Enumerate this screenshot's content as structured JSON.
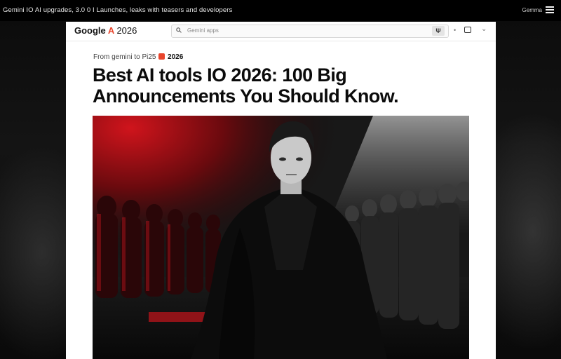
{
  "topbar": {
    "title": "Gemini IO AI upgrades, 3.0 0 I Launches, leaks with teasers and developers",
    "right_label": "Gemma",
    "menu_icon": "hamburger-icon"
  },
  "browser": {
    "logo_text": "Google",
    "logo_year": "2026",
    "search_placeholder": "Gemini apps",
    "icons": [
      "search-icon",
      "mic-icon",
      "more-icon",
      "camera-icon",
      "chevron-icon"
    ]
  },
  "article": {
    "kicker_prefix": "From gemini to Pi25",
    "kicker_year": "2026",
    "headline": "Best AI tools IO 2026: 100 Big Announcements You Should Know.",
    "hero_image": "portrait of a dark-haired man in a black cloak in front of a crowd, red and grey lighting"
  },
  "colors": {
    "accent": "#e8452c",
    "hero_red": "#b0141a"
  }
}
